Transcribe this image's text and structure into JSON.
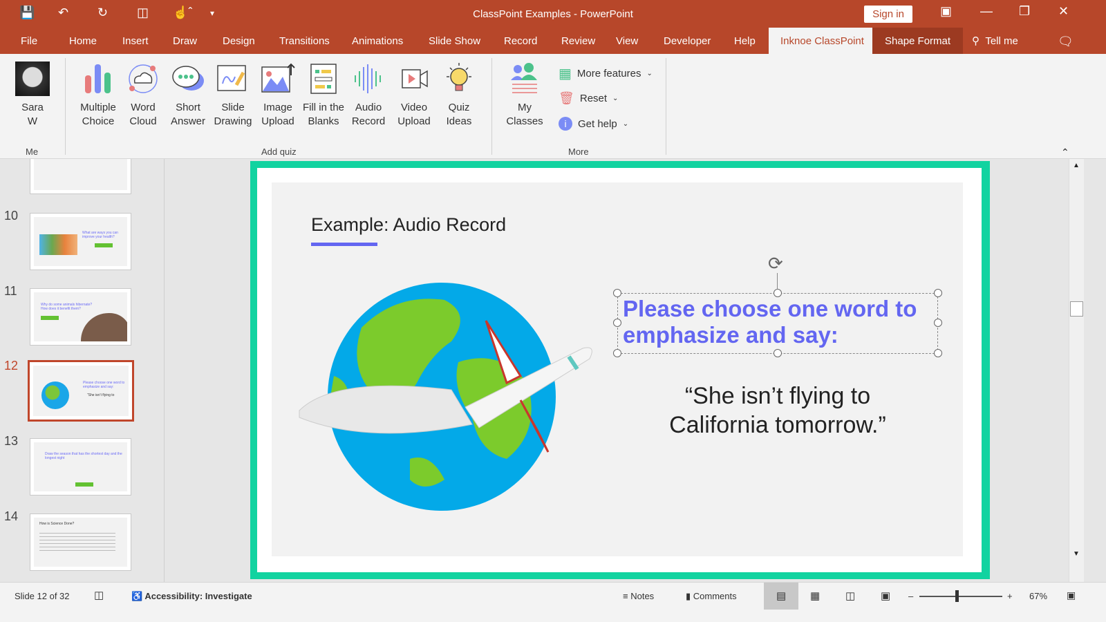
{
  "app": {
    "title": "ClassPoint Examples  -  PowerPoint",
    "sign_in": "Sign in"
  },
  "quick_access": [
    "save-icon",
    "undo-icon",
    "redo-icon",
    "present-icon",
    "touch-mode-icon",
    "customize-icon"
  ],
  "tabs": [
    "File",
    "Home",
    "Insert",
    "Draw",
    "Design",
    "Transitions",
    "Animations",
    "Slide Show",
    "Record",
    "Review",
    "View",
    "Developer",
    "Help",
    "Inknoe ClassPoint",
    "Shape Format"
  ],
  "active_tab": "Inknoe ClassPoint",
  "tell_me": "Tell me",
  "ribbon": {
    "me": {
      "name_line1": "Sara",
      "name_line2": "W",
      "group": "Me"
    },
    "add_quiz": {
      "group": "Add quiz",
      "buttons": [
        {
          "l1": "Multiple",
          "l2": "Choice"
        },
        {
          "l1": "Word",
          "l2": "Cloud"
        },
        {
          "l1": "Short",
          "l2": "Answer"
        },
        {
          "l1": "Slide",
          "l2": "Drawing"
        },
        {
          "l1": "Image",
          "l2": "Upload"
        },
        {
          "l1": "Fill in the",
          "l2": "Blanks"
        },
        {
          "l1": "Audio",
          "l2": "Record"
        },
        {
          "l1": "Video",
          "l2": "Upload"
        },
        {
          "l1": "Quiz",
          "l2": "Ideas"
        }
      ]
    },
    "more": {
      "group": "More",
      "my_classes_l1": "My",
      "my_classes_l2": "Classes",
      "more_features": "More features",
      "reset": "Reset",
      "get_help": "Get help"
    }
  },
  "thumbnails": [
    {
      "num": "10",
      "title": "What are ways you can improve your health?"
    },
    {
      "num": "11",
      "title": "Why do some animals hibernate? How does it benefit them?"
    },
    {
      "num": "12",
      "title": "Please choose one word to emphasize and say:"
    },
    {
      "num": "13",
      "title": "Draw the season that has the shortest day and the longest night"
    },
    {
      "num": "14",
      "title": "How is Science Done?"
    }
  ],
  "selected_slide": "12",
  "slide": {
    "heading": "Example: Audio Record",
    "prompt": "Please choose one word to emphasize and say:",
    "quote_l1": "“She isn’t flying to",
    "quote_l2": "California tomorrow.”",
    "accent": "#6366f1",
    "border": "#12d3a0"
  },
  "status": {
    "slide": "Slide 12 of 32",
    "accessibility": "Accessibility: Investigate",
    "notes": "Notes",
    "comments": "Comments",
    "zoom": "67%",
    "zoom_fraction": 0.45
  },
  "colors": {
    "brand": "#b7472a"
  }
}
